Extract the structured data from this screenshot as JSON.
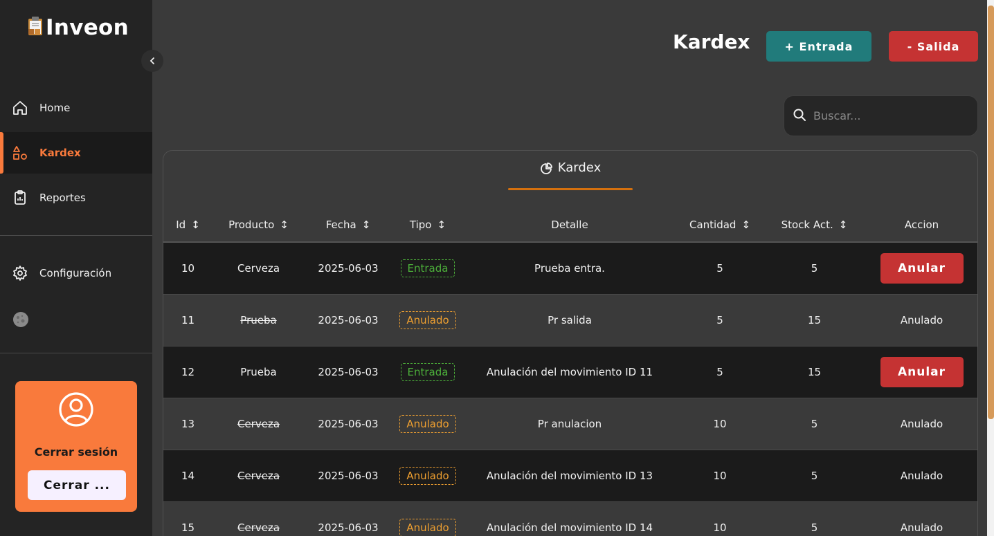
{
  "app": {
    "name": "Inveon"
  },
  "sidebar": {
    "items": [
      {
        "label": "Home",
        "icon": "home-icon"
      },
      {
        "label": "Kardex",
        "icon": "shapes-icon",
        "active": true
      },
      {
        "label": "Reportes",
        "icon": "clipboard-icon"
      }
    ],
    "settings_label": "Configuración",
    "logout": {
      "title": "Cerrar sesión",
      "button": "Cerrar ..."
    }
  },
  "header": {
    "title": "Kardex",
    "entrada_button": "+ Entrada",
    "salida_button": "- Salida"
  },
  "search": {
    "placeholder": "Buscar..."
  },
  "card": {
    "tab_label": "Kardex"
  },
  "table": {
    "columns": [
      "Id",
      "Producto",
      "Fecha",
      "Tipo",
      "Detalle",
      "Cantidad",
      "Stock Act.",
      "Accion"
    ],
    "rows": [
      {
        "id": "10",
        "producto": "Cerveza",
        "fecha": "2025-06-03",
        "tipo": "Entrada",
        "detalle": "Prueba entra.",
        "cantidad": "5",
        "stock": "5",
        "accion": "Anular"
      },
      {
        "id": "11",
        "producto": "Prueba",
        "fecha": "2025-06-03",
        "tipo": "Anulado",
        "detalle": "Pr salida",
        "cantidad": "5",
        "stock": "15",
        "accion": "Anulado"
      },
      {
        "id": "12",
        "producto": "Prueba",
        "fecha": "2025-06-03",
        "tipo": "Entrada",
        "detalle": "Anulación del movimiento ID 11",
        "cantidad": "5",
        "stock": "15",
        "accion": "Anular"
      },
      {
        "id": "13",
        "producto": "Cerveza",
        "fecha": "2025-06-03",
        "tipo": "Anulado",
        "detalle": "Pr anulacion",
        "cantidad": "10",
        "stock": "5",
        "accion": "Anulado"
      },
      {
        "id": "14",
        "producto": "Cerveza",
        "fecha": "2025-06-03",
        "tipo": "Anulado",
        "detalle": "Anulación del movimiento ID 13",
        "cantidad": "10",
        "stock": "5",
        "accion": "Anulado"
      },
      {
        "id": "15",
        "producto": "Cerveza",
        "fecha": "2025-06-03",
        "tipo": "Anulado",
        "detalle": "Anulación del movimiento ID 14",
        "cantidad": "10",
        "stock": "5",
        "accion": "Anulado"
      }
    ]
  },
  "colors": {
    "accent": "#f97a3c",
    "entrada": "#217b7b",
    "salida": "#c53333",
    "badge_entrada": "#4caf3a",
    "badge_anulado": "#f0a030"
  }
}
